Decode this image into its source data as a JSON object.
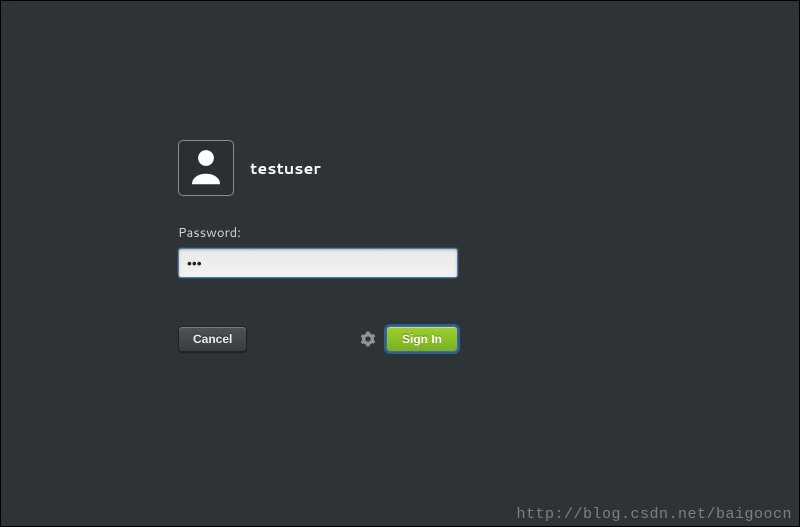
{
  "user": {
    "name": "testuser"
  },
  "password": {
    "label": "Password:",
    "value": "•••"
  },
  "buttons": {
    "cancel": "Cancel",
    "signin": "Sign In"
  },
  "watermark": "http://blog.csdn.net/baigoocn"
}
